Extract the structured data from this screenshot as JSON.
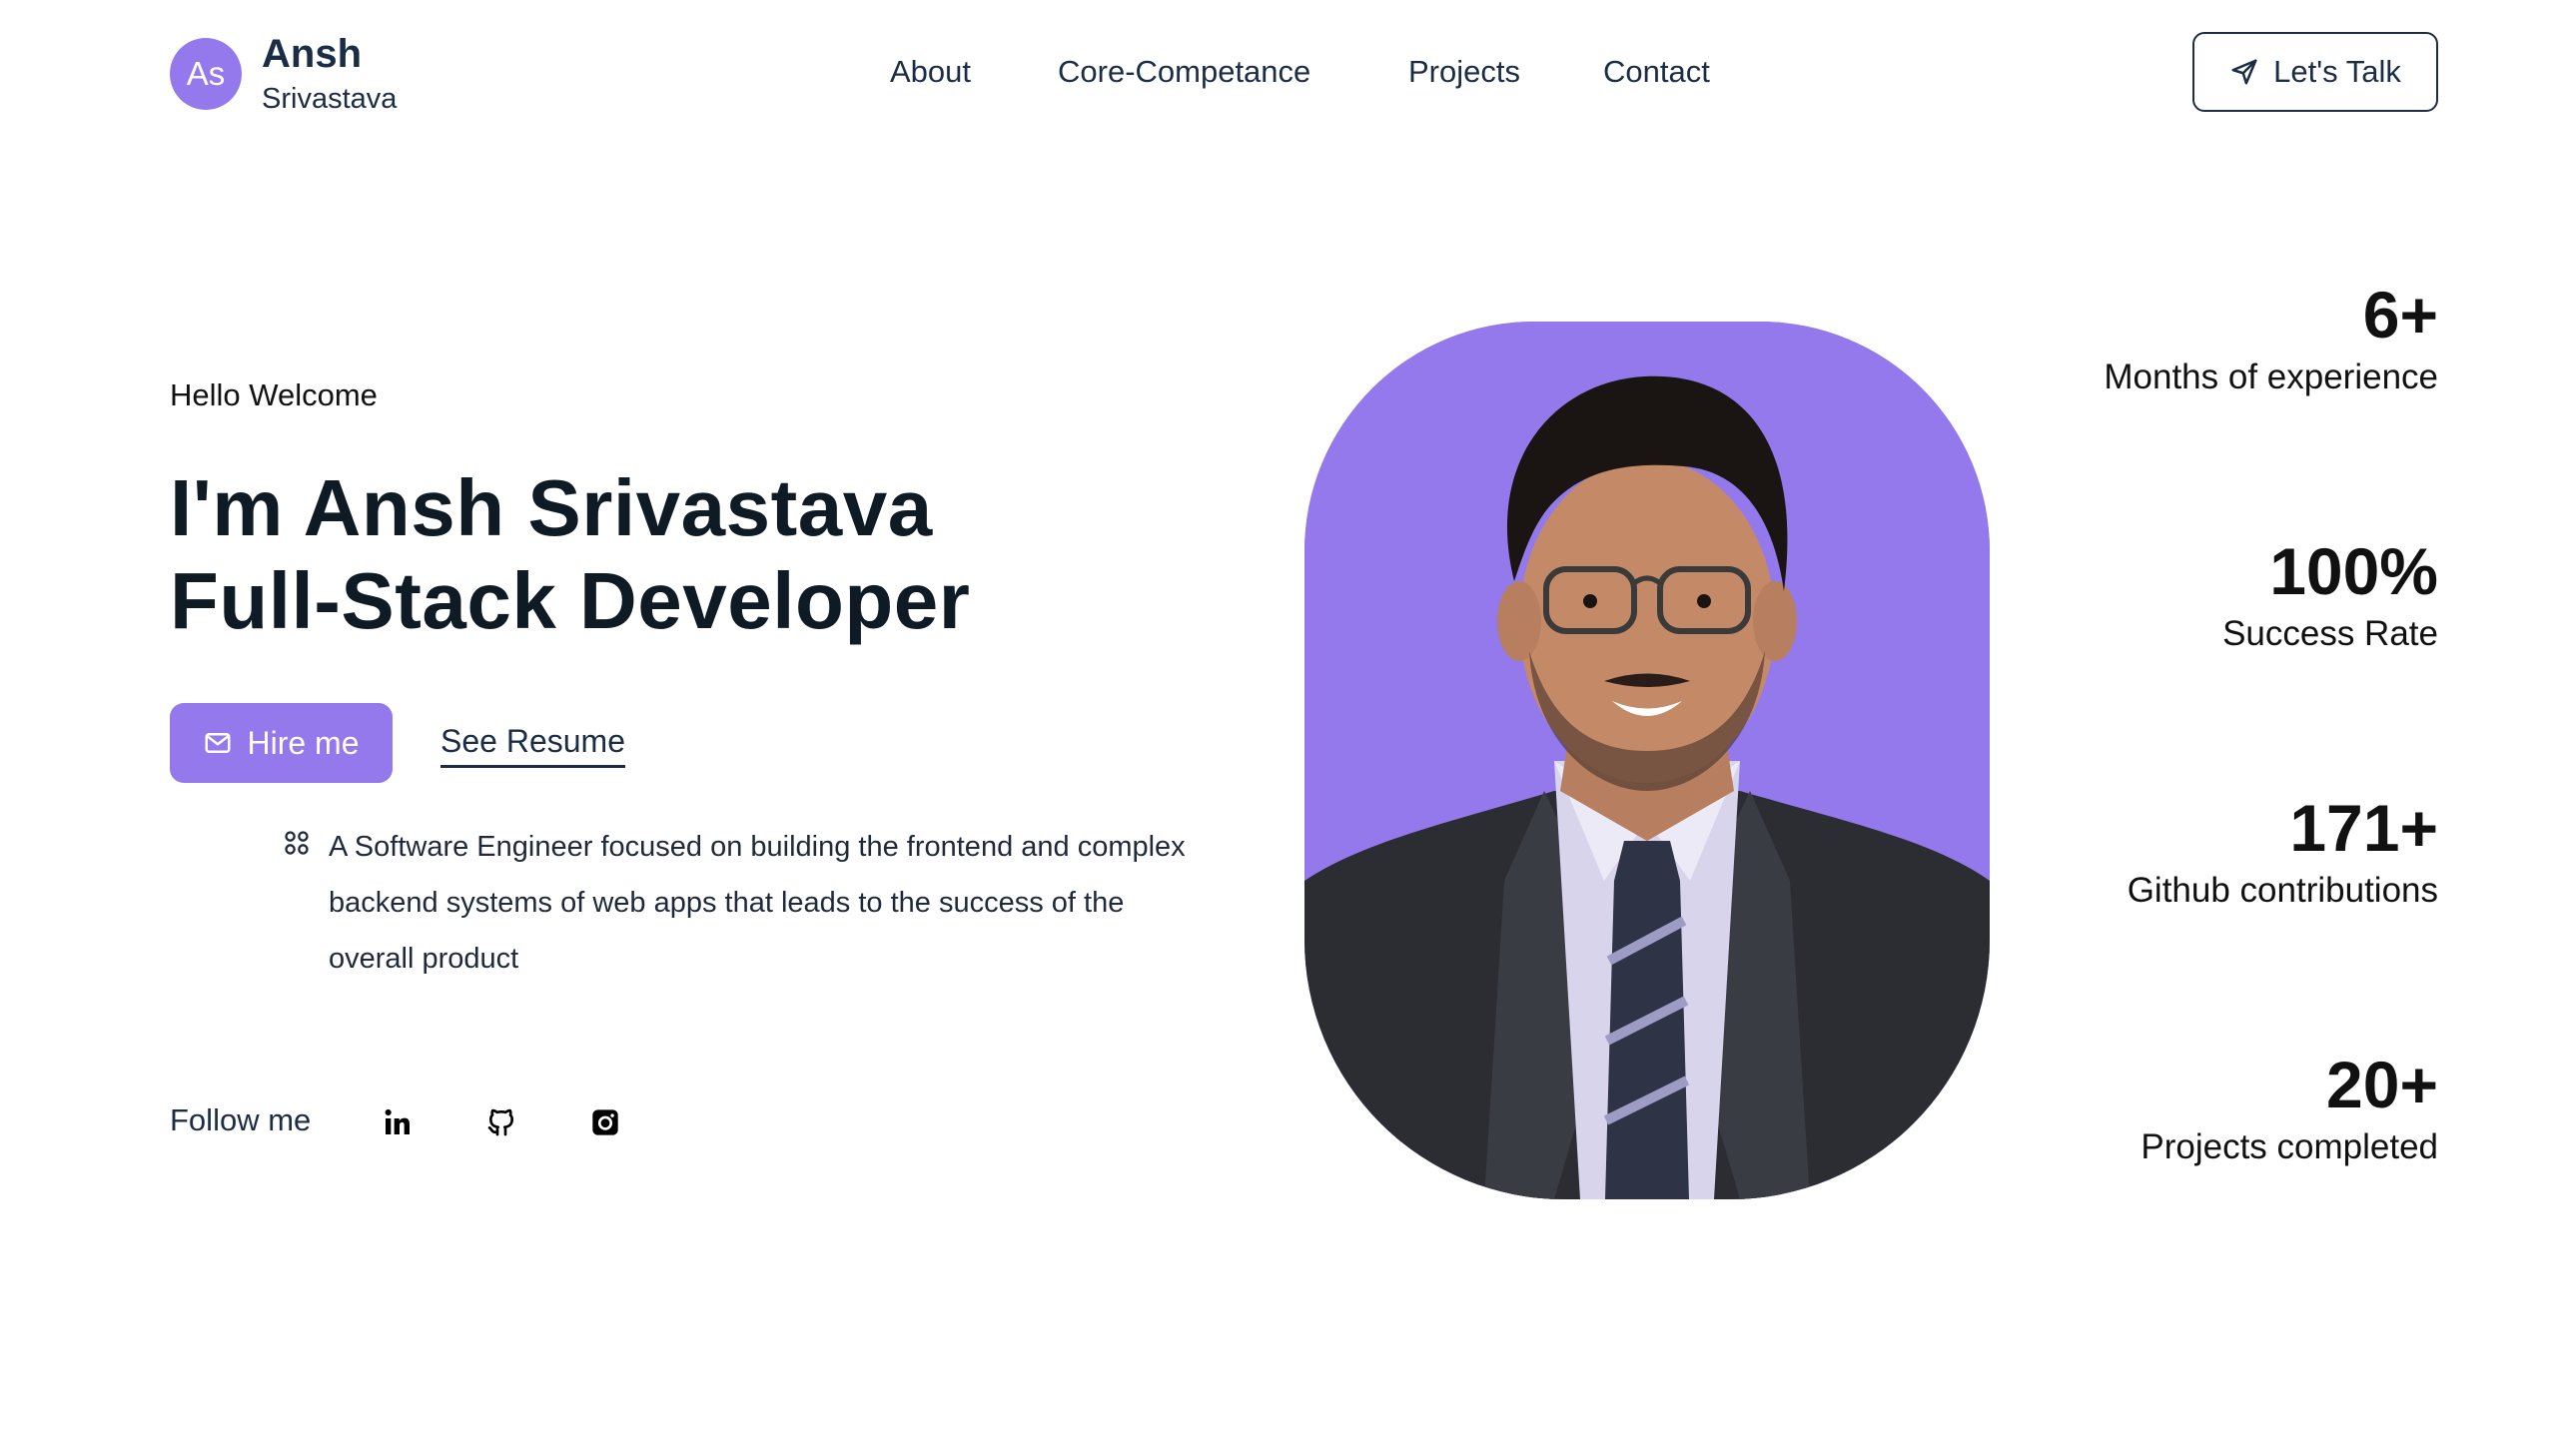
{
  "logo": {
    "initials": "As",
    "first_name": "Ansh",
    "last_name": "Srivastava"
  },
  "nav": {
    "items": [
      {
        "label": "About"
      },
      {
        "label": "Core-Competance"
      },
      {
        "label": "Projects"
      },
      {
        "label": "Contact"
      }
    ],
    "cta_label": "Let's Talk",
    "cta_icon": "send-icon"
  },
  "hero": {
    "greeting": "Hello Welcome",
    "headline_line1": "I'm Ansh Srivastava",
    "headline_line2": "Full-Stack Developer",
    "hire_label": "Hire me",
    "hire_icon": "mail-icon",
    "resume_label": "See Resume",
    "bio": "A Software Engineer focused on building the frontend and complex backend systems of web apps that leads to the success of the overall product",
    "bio_icon": "command-icon",
    "follow_label": "Follow me",
    "social": [
      {
        "name": "linkedin-icon"
      },
      {
        "name": "github-icon"
      },
      {
        "name": "instagram-icon"
      }
    ]
  },
  "stats": [
    {
      "value": "6+",
      "label": "Months of experience"
    },
    {
      "value": "100%",
      "label": "Success Rate"
    },
    {
      "value": "171+",
      "label": "Github contributions"
    },
    {
      "value": "20+",
      "label": "Projects completed"
    }
  ],
  "colors": {
    "accent": "#9379eb",
    "text_dark": "#0f1b24",
    "text_nav": "#1b2d45",
    "background": "#ffffff"
  }
}
